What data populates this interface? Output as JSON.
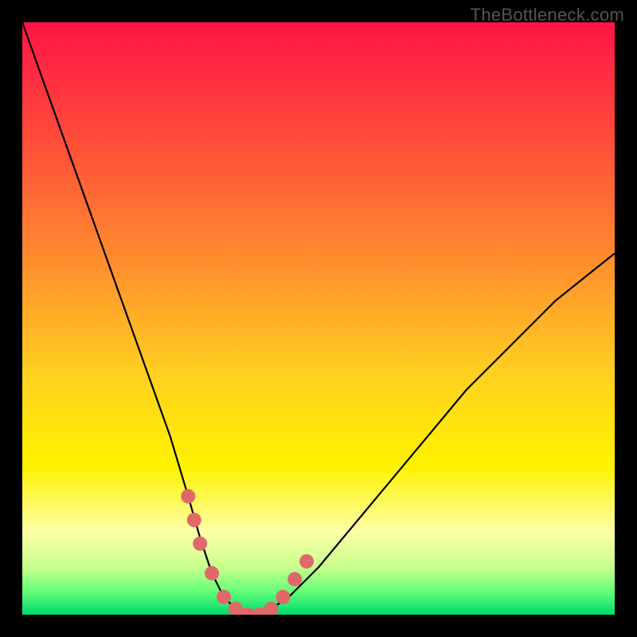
{
  "watermark": "TheBottleneck.com",
  "chart_data": {
    "type": "line",
    "title": "",
    "xlabel": "",
    "ylabel": "",
    "ylim": [
      0,
      100
    ],
    "xlim": [
      0,
      100
    ],
    "series": [
      {
        "name": "bottleneck-curve",
        "x": [
          0,
          5,
          10,
          15,
          20,
          25,
          28,
          30,
          32,
          34,
          36,
          38,
          40,
          42,
          45,
          50,
          55,
          60,
          65,
          70,
          75,
          80,
          85,
          90,
          95,
          100
        ],
        "values": [
          100,
          86,
          72,
          58,
          44,
          30,
          20,
          13,
          7,
          3,
          1,
          0,
          0,
          1,
          3,
          8,
          14,
          20,
          26,
          32,
          38,
          43,
          48,
          53,
          57,
          61
        ]
      },
      {
        "name": "highlight-dots",
        "x": [
          28,
          29,
          30,
          32,
          34,
          36,
          38,
          40,
          42,
          44,
          46,
          48
        ],
        "values": [
          20,
          16,
          12,
          7,
          3,
          1,
          0,
          0,
          1,
          3,
          6,
          9
        ]
      }
    ],
    "gradient_stops": [
      {
        "offset": 0,
        "color": "#ff1447"
      },
      {
        "offset": 20,
        "color": "#ff4d3a"
      },
      {
        "offset": 40,
        "color": "#ff8c2e"
      },
      {
        "offset": 60,
        "color": "#ffd21f"
      },
      {
        "offset": 75,
        "color": "#fff200"
      },
      {
        "offset": 86,
        "color": "#fdffa8"
      },
      {
        "offset": 92,
        "color": "#c8ff8c"
      },
      {
        "offset": 96,
        "color": "#66ff7a"
      },
      {
        "offset": 100,
        "color": "#00d96b"
      }
    ]
  }
}
